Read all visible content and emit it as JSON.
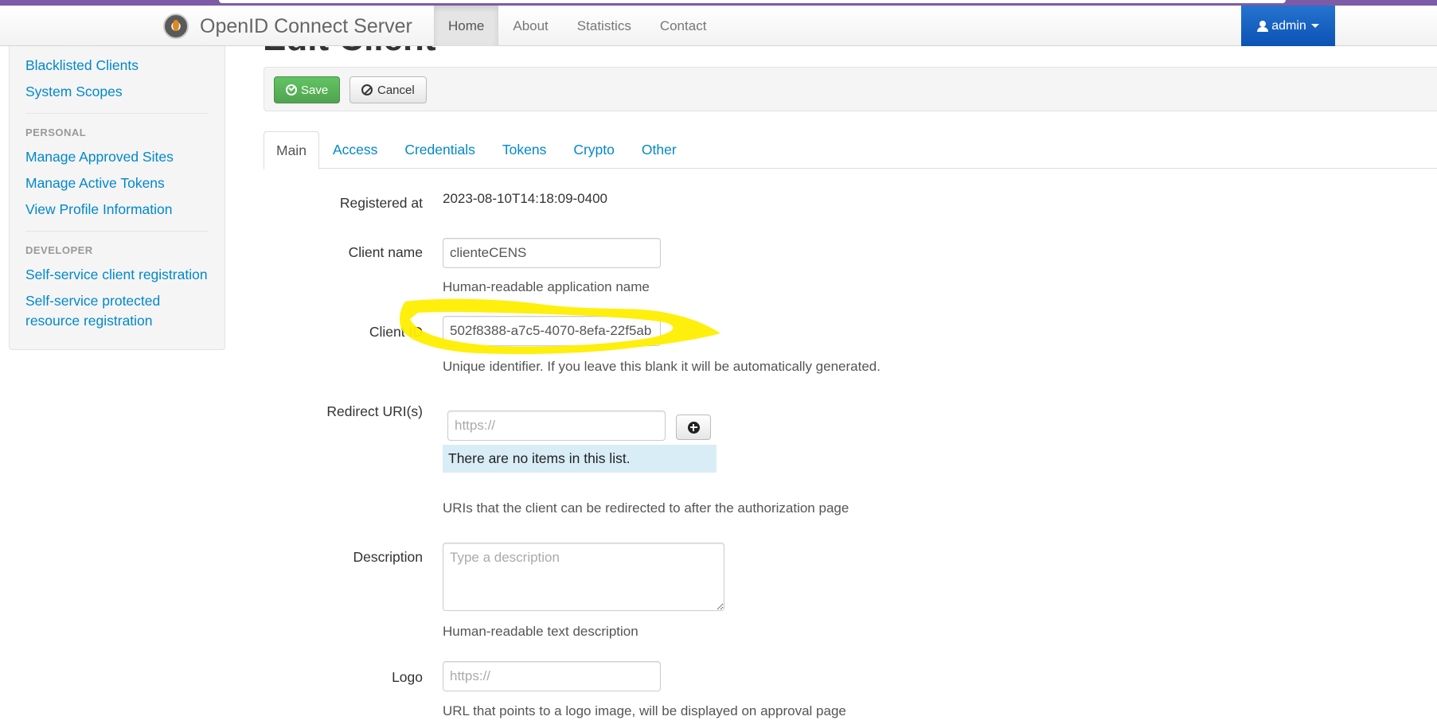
{
  "navbar": {
    "brand": "OpenID Connect Server",
    "items": [
      {
        "label": "Home",
        "active": true
      },
      {
        "label": "About"
      },
      {
        "label": "Statistics"
      },
      {
        "label": "Contact"
      }
    ],
    "user_menu": "admin"
  },
  "page": {
    "heading": "Edit Client"
  },
  "sidebar": {
    "admin_links": [
      "Blacklisted Clients",
      "System Scopes"
    ],
    "personal_header": "PERSONAL",
    "personal_links": [
      "Manage Approved Sites",
      "Manage Active Tokens",
      "View Profile Information"
    ],
    "developer_header": "DEVELOPER",
    "developer_links": [
      "Self-service client registration",
      "Self-service protected resource registration"
    ]
  },
  "toolbar": {
    "save_label": "Save",
    "cancel_label": "Cancel"
  },
  "tabs": [
    "Main",
    "Access",
    "Credentials",
    "Tokens",
    "Crypto",
    "Other"
  ],
  "form": {
    "registered_at": {
      "label": "Registered at",
      "value": "2023-08-10T14:18:09-0400"
    },
    "client_name": {
      "label": "Client name",
      "value": "clienteCENS",
      "help": "Human-readable application name"
    },
    "client_id": {
      "label": "Client ID",
      "value": "502f8388-a7c5-4070-8efa-22f5ab",
      "help": "Unique identifier. If you leave this blank it will be automatically generated."
    },
    "redirect_uris": {
      "label": "Redirect URI(s)",
      "placeholder": "https://",
      "empty_text": "There are no items in this list.",
      "help": "URIs that the client can be redirected to after the authorization page"
    },
    "description": {
      "label": "Description",
      "placeholder": "Type a description",
      "help": "Human-readable text description"
    },
    "logo": {
      "label": "Logo",
      "placeholder": "https://",
      "help": "URL that points to a logo image, will be displayed on approval page"
    }
  },
  "colors": {
    "link": "#0088cc",
    "highlight": "#ffee00",
    "admin_button": "#1565c0",
    "save_button": "#5bb75b",
    "info_box": "#d9edf7"
  }
}
